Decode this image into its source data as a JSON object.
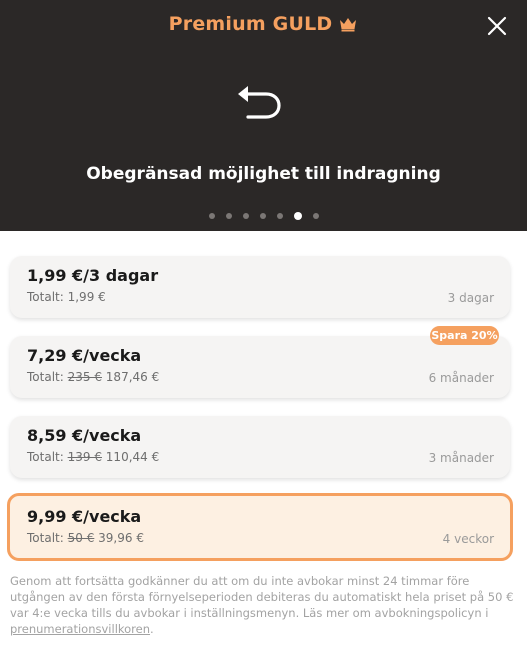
{
  "header": {
    "title": "Premium GULD",
    "title_icon": "crown-icon",
    "close_icon": "close-icon",
    "feature_icon": "undo-arrow-icon",
    "feature_title": "Obegränsad möjlighet till indragning",
    "carousel": {
      "total": 7,
      "active_index": 5
    },
    "colors": {
      "background": "#2b2827",
      "accent": "#f5a05f"
    }
  },
  "plans": [
    {
      "price": "1,99 €/3 dagar",
      "total_label": "Totalt:",
      "original_total": "",
      "total": "1,99 €",
      "duration": "3 dagar",
      "selected": false
    },
    {
      "price": "7,29 €/vecka",
      "total_label": "Totalt:",
      "original_total": "235 €",
      "total": "187,46 €",
      "duration": "6 månader",
      "selected": false,
      "badge": "Spara 20%"
    },
    {
      "price": "8,59 €/vecka",
      "total_label": "Totalt:",
      "original_total": "139 €",
      "total": "110,44 €",
      "duration": "3 månader",
      "selected": false
    },
    {
      "price": "9,99 €/vecka",
      "total_label": "Totalt:",
      "original_total": "50 €",
      "total": "39,96 €",
      "duration": "4 veckor",
      "selected": true
    }
  ],
  "disclaimer": {
    "text": "Genom att fortsätta godkänner du att om du inte avbokar minst 24 timmar före utgången av den första förnyelseperioden debiteras du automatiskt hela priset på 50 € var 4:e vecka tills du avbokar i inställningsmenyn. Läs mer om avbokningspolicyn i ",
    "link": "prenumerationsvillkoren",
    "end": "."
  }
}
